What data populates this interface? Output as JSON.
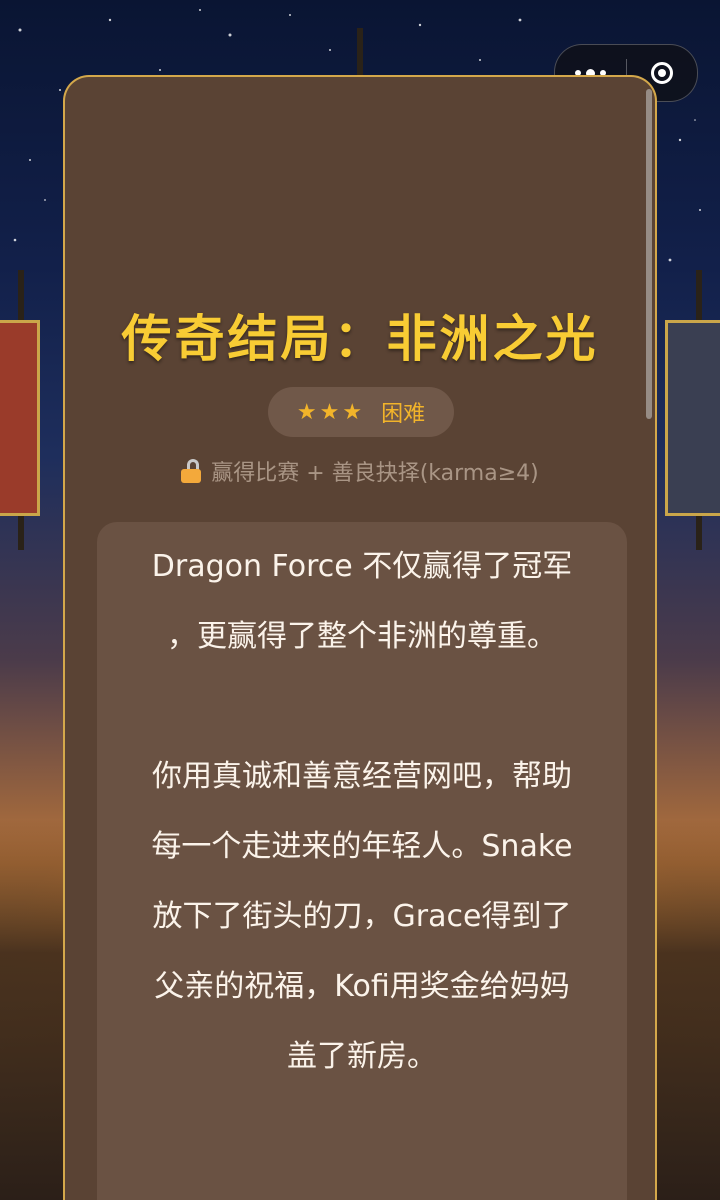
{
  "capsule": {
    "more_icon": "more-dots-icon",
    "close_icon": "target-circle-icon"
  },
  "ending": {
    "title": "传奇结局：非洲之光",
    "stars": "★★★",
    "difficulty": "困难",
    "unlock_icon": "unlock-icon",
    "unlock_condition": "赢得比赛 + 善良抉择(karma≥4)",
    "paragraphs": [
      [
        "Dragon Force 不仅赢得了冠军",
        "，更赢得了整个非洲的尊重。"
      ],
      [
        "你用真诚和善意经营网吧，帮助",
        "每一个走进来的年轻人。Snake",
        "放下了街头的刀，Grace得到了",
        "父亲的祝福，Kofi用奖金给妈妈",
        "盖了新房。"
      ]
    ]
  },
  "colors": {
    "title": "#f8cc34",
    "card": "#5a4334",
    "border": "#d4a84b",
    "text": "#fbf3ea"
  }
}
